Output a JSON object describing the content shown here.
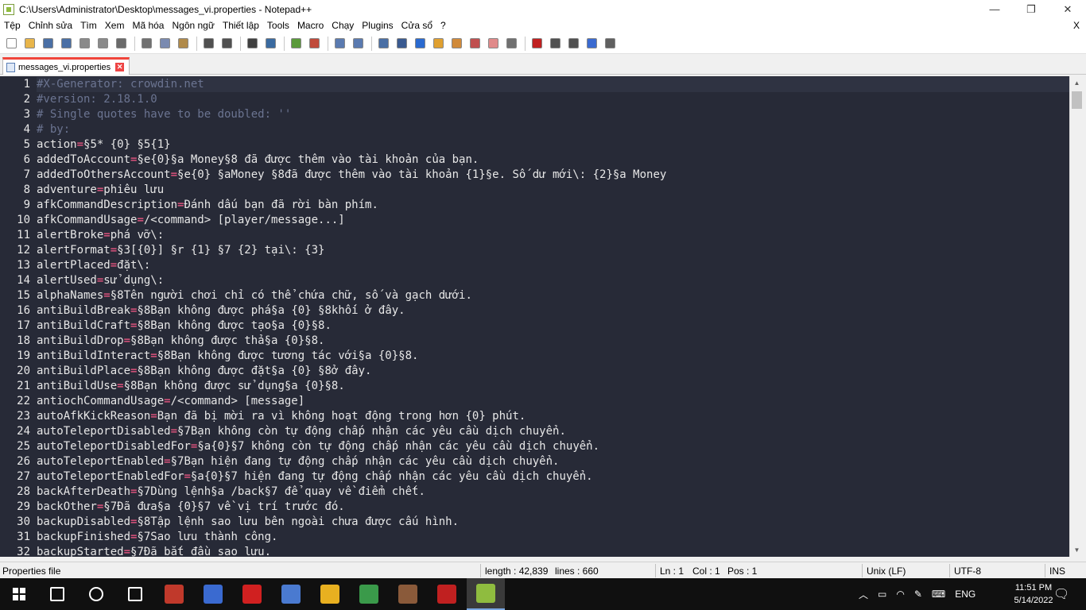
{
  "window": {
    "title": "C:\\Users\\Administrator\\Desktop\\messages_vi.properties - Notepad++",
    "minimize": "—",
    "restore": "❐",
    "close": "✕"
  },
  "menu": {
    "items": [
      "Tệp",
      "Chỉnh sửa",
      "Tìm",
      "Xem",
      "Mã hóa",
      "Ngôn ngữ",
      "Thiết lập",
      "Tools",
      "Macro",
      "Chạy",
      "Plugins",
      "Cửa sổ",
      "?"
    ],
    "close": "X"
  },
  "toolbar": {
    "buttons": [
      {
        "name": "new-file-icon",
        "color": "#ffffff"
      },
      {
        "name": "open-file-icon",
        "color": "#e8b54a"
      },
      {
        "name": "save-icon",
        "color": "#4a6fa5"
      },
      {
        "name": "save-all-icon",
        "color": "#4a6fa5"
      },
      {
        "name": "close-icon",
        "color": "#8a8a8a"
      },
      {
        "name": "close-all-icon",
        "color": "#8a8a8a"
      },
      {
        "name": "print-icon",
        "color": "#6a6a6a"
      },
      {
        "name": "cut-icon",
        "color": "#707070"
      },
      {
        "name": "copy-icon",
        "color": "#7a8ab0"
      },
      {
        "name": "paste-icon",
        "color": "#b08a4a"
      },
      {
        "name": "undo-icon",
        "color": "#505050"
      },
      {
        "name": "redo-icon",
        "color": "#505050"
      },
      {
        "name": "find-icon",
        "color": "#404040"
      },
      {
        "name": "replace-icon",
        "color": "#3a6aa0"
      },
      {
        "name": "zoom-in-icon",
        "color": "#5a9a3a"
      },
      {
        "name": "zoom-out-icon",
        "color": "#c04a3a"
      },
      {
        "name": "sync-vertical-icon",
        "color": "#5a7ab0"
      },
      {
        "name": "sync-horizontal-icon",
        "color": "#5a7ab0"
      },
      {
        "name": "word-wrap-icon",
        "color": "#4a6fa5"
      },
      {
        "name": "show-all-chars-icon",
        "color": "#3a5a90"
      },
      {
        "name": "indent-guide-icon",
        "color": "#2a6ad0"
      },
      {
        "name": "user-language-icon",
        "color": "#e0a030"
      },
      {
        "name": "doc-map-icon",
        "color": "#d08a3a"
      },
      {
        "name": "function-list-icon",
        "color": "#c05050"
      },
      {
        "name": "folder-workspace-icon",
        "color": "#e08a8a"
      },
      {
        "name": "monitoring-icon",
        "color": "#707070"
      },
      {
        "name": "record-macro-icon",
        "color": "#c02020"
      },
      {
        "name": "stop-macro-icon",
        "color": "#505050"
      },
      {
        "name": "play-macro-icon",
        "color": "#505050"
      },
      {
        "name": "run-macro-multiple-icon",
        "color": "#3a6ad0"
      },
      {
        "name": "save-macro-icon",
        "color": "#606060"
      }
    ]
  },
  "tab": {
    "label": "messages_vi.properties",
    "close": "✕"
  },
  "editor": {
    "lines": [
      {
        "n": "1",
        "type": "comment",
        "text": "#X-Generator: crowdin.net"
      },
      {
        "n": "2",
        "type": "comment",
        "text": "#version: 2.18.1.0"
      },
      {
        "n": "3",
        "type": "comment",
        "text": "# Single quotes have to be doubled: ''"
      },
      {
        "n": "4",
        "type": "comment",
        "text": "# by:"
      },
      {
        "n": "5",
        "type": "kv",
        "key": "action",
        "val": "§5* {0} §5{1}"
      },
      {
        "n": "6",
        "type": "kv",
        "key": "addedToAccount",
        "val": "§e{0}§a Money§8 đã được thêm vào tài khoản của bạn."
      },
      {
        "n": "7",
        "type": "kv",
        "key": "addedToOthersAccount",
        "val": "§e{0} §aMoney §8đã được thêm vào tài khoản {1}§e. Số dư mới\\: {2}§a Money"
      },
      {
        "n": "8",
        "type": "kv",
        "key": "adventure",
        "val": "phiêu lưu"
      },
      {
        "n": "9",
        "type": "kv",
        "key": "afkCommandDescription",
        "val": "Đánh dấu bạn đã rời bàn phím."
      },
      {
        "n": "10",
        "type": "kv",
        "key": "afkCommandUsage",
        "val": "/<command> [player/message...]"
      },
      {
        "n": "11",
        "type": "kv",
        "key": "alertBroke",
        "val": "phá vỡ\\:"
      },
      {
        "n": "12",
        "type": "kv",
        "key": "alertFormat",
        "val": "§3[{0}] §r {1} §7 {2} tại\\: {3}"
      },
      {
        "n": "13",
        "type": "kv",
        "key": "alertPlaced",
        "val": "đặt\\:"
      },
      {
        "n": "14",
        "type": "kv",
        "key": "alertUsed",
        "val": "sử dụng\\:"
      },
      {
        "n": "15",
        "type": "kv",
        "key": "alphaNames",
        "val": "§8Tên người chơi chỉ có thể chứa chữ, số và gạch dưới."
      },
      {
        "n": "16",
        "type": "kv",
        "key": "antiBuildBreak",
        "val": "§8Bạn không được phá§a {0} §8khối ở đây."
      },
      {
        "n": "17",
        "type": "kv",
        "key": "antiBuildCraft",
        "val": "§8Bạn không được tạo§a {0}§8."
      },
      {
        "n": "18",
        "type": "kv",
        "key": "antiBuildDrop",
        "val": "§8Bạn không được thả§a {0}§8."
      },
      {
        "n": "19",
        "type": "kv",
        "key": "antiBuildInteract",
        "val": "§8Bạn không được tương tác với§a {0}§8."
      },
      {
        "n": "20",
        "type": "kv",
        "key": "antiBuildPlace",
        "val": "§8Bạn không được đặt§a {0} §8ở đây."
      },
      {
        "n": "21",
        "type": "kv",
        "key": "antiBuildUse",
        "val": "§8Bạn không được sử dụng§a {0}§8."
      },
      {
        "n": "22",
        "type": "kv",
        "key": "antiochCommandUsage",
        "val": "/<command> [message]"
      },
      {
        "n": "23",
        "type": "kv",
        "key": "autoAfkKickReason",
        "val": "Bạn đã bị mời ra vì không hoạt động trong hơn {0} phút."
      },
      {
        "n": "24",
        "type": "kv",
        "key": "autoTeleportDisabled",
        "val": "§7Bạn không còn tự động chấp nhận các yêu cầu dịch chuyển."
      },
      {
        "n": "25",
        "type": "kv",
        "key": "autoTeleportDisabledFor",
        "val": "§a{0}§7 không còn tự động chấp nhận các yêu cầu dịch chuyển."
      },
      {
        "n": "26",
        "type": "kv",
        "key": "autoTeleportEnabled",
        "val": "§7Bạn hiện đang tự động chấp nhận các yêu cầu dịch chuyển."
      },
      {
        "n": "27",
        "type": "kv",
        "key": "autoTeleportEnabledFor",
        "val": "§a{0}§7 hiện đang tự động chấp nhận các yêu cầu dịch chuyển."
      },
      {
        "n": "28",
        "type": "kv",
        "key": "backAfterDeath",
        "val": "§7Dùng lệnh§a /back§7 để quay về điểm chết."
      },
      {
        "n": "29",
        "type": "kv",
        "key": "backOther",
        "val": "§7Đã đưa§a {0}§7 về vị trí trước đó."
      },
      {
        "n": "30",
        "type": "kv",
        "key": "backupDisabled",
        "val": "§8Tập lệnh sao lưu bên ngoài chưa được cấu hình."
      },
      {
        "n": "31",
        "type": "kv",
        "key": "backupFinished",
        "val": "§7Sao lưu thành công."
      },
      {
        "n": "32",
        "type": "kv",
        "key": "backupStarted",
        "val": "§7Đã bắt đầu sao lưu."
      }
    ]
  },
  "status": {
    "file_type": "Properties file",
    "length": "length : 42,839",
    "lines": "lines : 660",
    "ln": "Ln : 1",
    "col": "Col : 1",
    "pos": "Pos : 1",
    "eol": "Unix (LF)",
    "encoding": "UTF-8",
    "mode": "INS"
  },
  "taskbar": {
    "apps": [
      {
        "name": "search-icon",
        "color": "#101010"
      },
      {
        "name": "cortana-icon",
        "color": "#101010"
      },
      {
        "name": "task-view-icon",
        "color": "#101010"
      },
      {
        "name": "app-tools-icon",
        "color": "#c0392b"
      },
      {
        "name": "dev-icon",
        "color": "#3a6ad0"
      },
      {
        "name": "record-icon",
        "color": "#d02020"
      },
      {
        "name": "app-installer-icon",
        "color": "#4a7ad0"
      },
      {
        "name": "chrome-icon",
        "color": "#e8b020"
      },
      {
        "name": "chrome-profile-icon",
        "color": "#3a9a4a"
      },
      {
        "name": "minecraft-icon",
        "color": "#8a5a3a"
      },
      {
        "name": "filezilla-icon",
        "color": "#c02020"
      },
      {
        "name": "notepadpp-icon",
        "color": "#8fbc3f"
      }
    ],
    "language": "ENG",
    "time": "11:51 PM",
    "date": "5/14/2022"
  }
}
